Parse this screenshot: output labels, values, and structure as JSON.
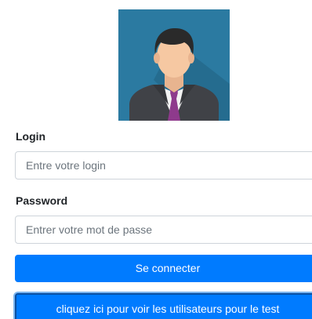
{
  "form": {
    "login_label": "Login",
    "login_placeholder": "Entre votre login",
    "password_label": "Password",
    "password_placeholder": "Entrer votre mot de passe",
    "submit_label": "Se connecter",
    "test_users_label": "cliquez ici pour voir les utilisateurs pour le test"
  },
  "avatar": {
    "icon": "user-avatar-icon",
    "background_color": "#2b7aa1"
  },
  "colors": {
    "primary": "#007bff",
    "label_text": "#212529",
    "input_border": "#ced4da"
  }
}
